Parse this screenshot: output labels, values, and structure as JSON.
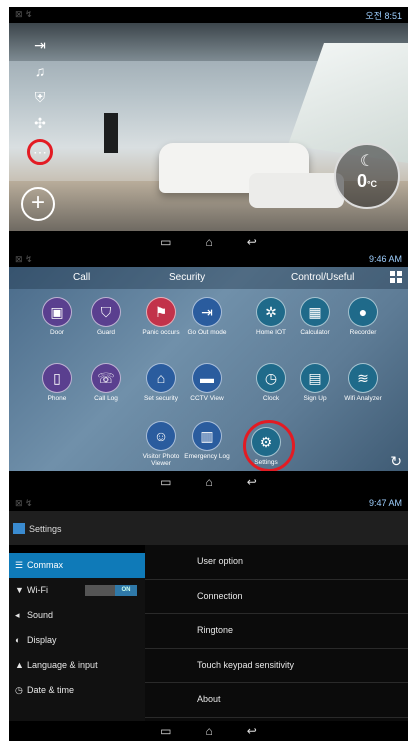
{
  "panel1": {
    "status_time": "오전 8:51",
    "left_menu_icons": [
      "logout-icon",
      "bell-icon",
      "shield-icon",
      "cube-icon",
      "more-icon"
    ],
    "add_label": "+",
    "temperature": "0",
    "temperature_unit": "°C",
    "nav": [
      "▭",
      "⌂",
      "↩"
    ]
  },
  "panel2": {
    "status_time": "9:46 AM",
    "tabs": [
      "Call",
      "Security",
      "Control/Useful"
    ],
    "apps": [
      {
        "label": "Door"
      },
      {
        "label": "Guard"
      },
      {
        "label": "Panic occurs"
      },
      {
        "label": "Go Out mode"
      },
      {
        "label": "Home IOT"
      },
      {
        "label": "Calculator"
      },
      {
        "label": "Recorder"
      },
      {
        "label": "Phone"
      },
      {
        "label": "Call Log"
      },
      {
        "label": "Set security"
      },
      {
        "label": "CCTV View"
      },
      {
        "label": "Clock"
      },
      {
        "label": "Sign Up"
      },
      {
        "label": "Wifi Analyzer"
      },
      {
        "label": "Visitor Photo Viewer"
      },
      {
        "label": "Emergency Log"
      },
      {
        "label": "Settings"
      }
    ],
    "nav": [
      "▭",
      "⌂",
      "↩"
    ]
  },
  "panel3": {
    "status_time": "9:47 AM",
    "title": "Settings",
    "sidebar": [
      {
        "label": "Commax",
        "icon": "list-icon"
      },
      {
        "label": "Wi-Fi",
        "icon": "wifi-icon",
        "toggle": "ON"
      },
      {
        "label": "Sound",
        "icon": "speaker-icon"
      },
      {
        "label": "Display",
        "icon": "display-icon"
      },
      {
        "label": "Language & input",
        "icon": "keyboard-icon"
      },
      {
        "label": "Date & time",
        "icon": "clock-icon"
      }
    ],
    "options": [
      "User option",
      "Connection",
      "Ringtone",
      "Touch keypad sensitivity",
      "About"
    ],
    "nav": [
      "▭",
      "⌂",
      "↩"
    ]
  },
  "colors": {
    "highlight": "#e31b23",
    "accent": "#0f7ab8"
  }
}
